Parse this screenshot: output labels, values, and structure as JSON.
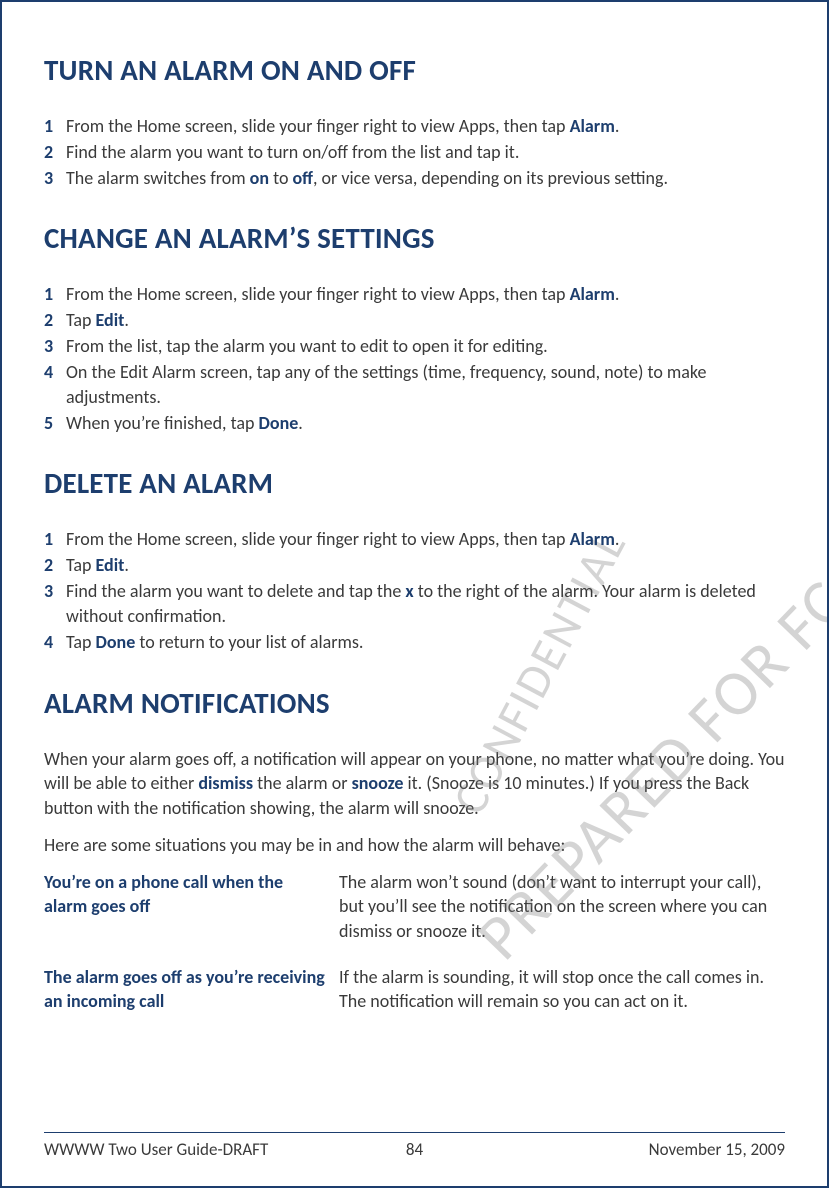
{
  "watermarks": {
    "w1": "PREPARED FOR FCC CERTIFICATION",
    "w2": "CONFIDENTIAL"
  },
  "sections": [
    {
      "heading": "TURN AN ALARM ON AND OFF",
      "steps": [
        {
          "n": "1",
          "pre": "From the Home screen, slide your finger right to view Apps, then tap ",
          "s1": "Alarm",
          "post": "."
        },
        {
          "n": "2",
          "pre": "Find the alarm you want to turn on/off from the list and tap it."
        },
        {
          "n": "3",
          "pre": "The alarm switches from ",
          "s1": "on",
          "mid": " to ",
          "s2": "off",
          "post": ", or vice versa, depending on its previous setting."
        }
      ]
    },
    {
      "heading": "CHANGE AN ALARM’S SETTINGS",
      "steps": [
        {
          "n": "1",
          "pre": "From the Home screen, slide your finger right to view Apps, then tap ",
          "s1": "Alarm",
          "post": "."
        },
        {
          "n": "2",
          "pre": "Tap ",
          "s1": "Edit",
          "post": "."
        },
        {
          "n": "3",
          "pre": "From the list, tap the alarm you want to edit to open it for editing."
        },
        {
          "n": "4",
          "pre": "On the Edit Alarm screen, tap any of the settings (time, frequency, sound, note) to make adjustments."
        },
        {
          "n": "5",
          "pre": "When you’re finished, tap ",
          "s1": "Done",
          "post": "."
        }
      ]
    },
    {
      "heading": "DELETE AN ALARM",
      "steps": [
        {
          "n": "1",
          "pre": "From the Home screen, slide your finger right to view Apps, then tap ",
          "s1": "Alarm",
          "post": "."
        },
        {
          "n": "2",
          "pre": "Tap ",
          "s1": "Edit",
          "post": "."
        },
        {
          "n": "3",
          "pre": "Find the alarm you want to delete and tap the ",
          "s1": "x",
          "post": " to the right of the alarm. Your alarm is deleted without confirmation."
        },
        {
          "n": "4",
          "pre": "Tap ",
          "s1": "Done",
          "post": " to return to your list of alarms."
        }
      ]
    }
  ],
  "notif": {
    "heading": "ALARM NOTIFICATIONS",
    "p1a": "When your alarm goes off, a notification will appear on your phone, no matter what you’re doing. You will be able to either ",
    "p1s1": "dismiss",
    "p1b": " the alarm or ",
    "p1s2": "snooze",
    "p1c": " it. (Snooze is 10 minutes.) If you press the Back button with the notification showing, the alarm will snooze.",
    "p2": "Here are some situations you may be in and how the alarm will behave:",
    "rows": [
      {
        "label": "You’re on a phone call when the alarm goes off",
        "text": "The alarm won’t sound (don’t want to interrupt your call), but you’ll see the notification on the screen where you can dismiss or snooze it."
      },
      {
        "label": "The alarm goes off as you’re receiving an incoming call",
        "text": "If the alarm is sounding, it will stop once the call comes in. The notification will remain so you can act on it."
      }
    ]
  },
  "footer": {
    "left": "WWWW Two User Guide-DRAFT",
    "center": "84",
    "right": "November 15, 2009"
  }
}
